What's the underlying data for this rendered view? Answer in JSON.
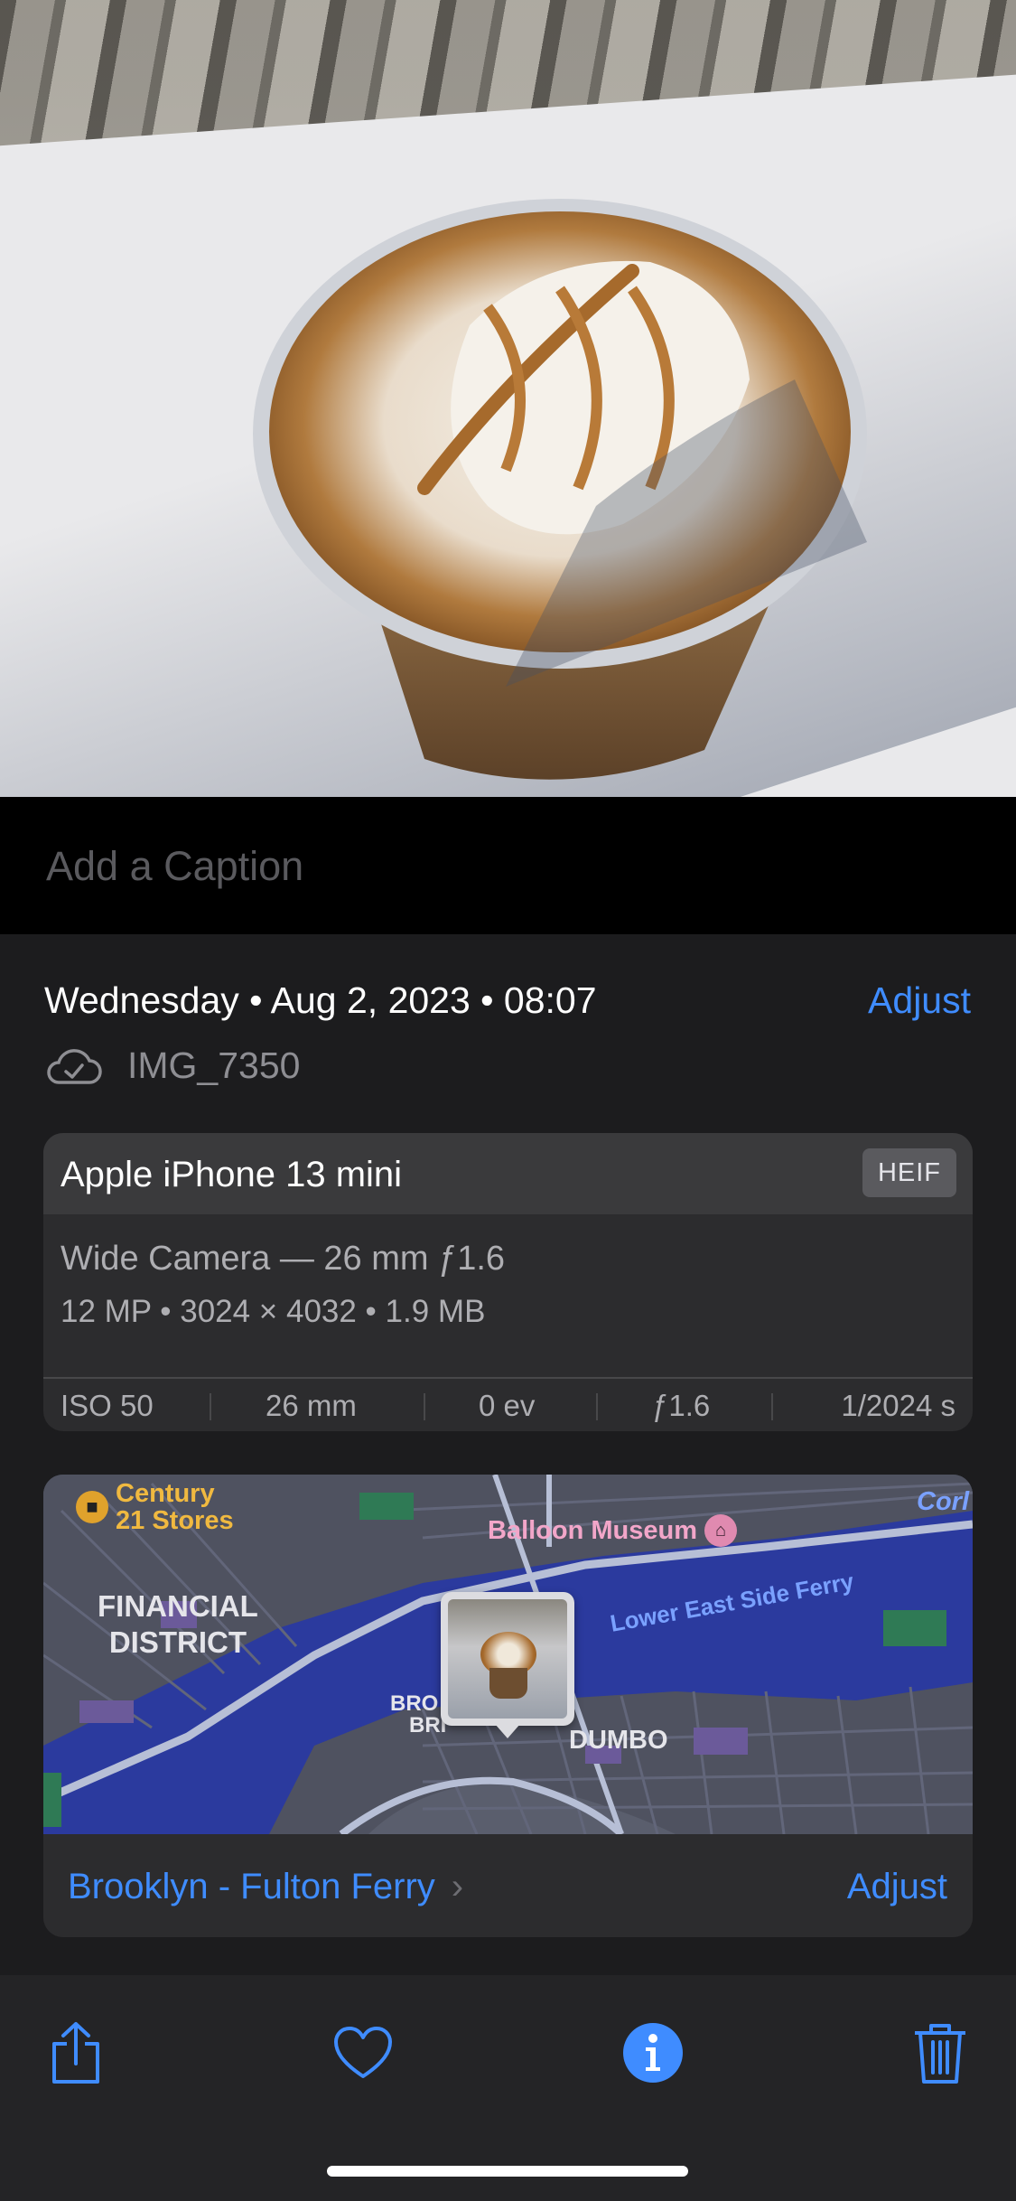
{
  "caption": {
    "placeholder": "Add a Caption"
  },
  "info": {
    "date": "Wednesday • Aug 2, 2023 • 08:07",
    "adjust_label": "Adjust",
    "filename": "IMG_7350",
    "cloud_icon": "icloud-synced-icon"
  },
  "camera": {
    "device": "Apple iPhone 13 mini",
    "format_badge": "HEIF",
    "lens": "Wide Camera — 26 mm ƒ1.6",
    "specs": "12 MP  •  3024 × 4032  •  1.9 MB",
    "exif": [
      "ISO 50",
      "26 mm",
      "0 ev",
      "ƒ1.6",
      "1/2024 s"
    ]
  },
  "map": {
    "labels": {
      "century": "Century",
      "century2": "21 Stores",
      "balloon": "Balloon Museum",
      "financial": "FINANCIAL",
      "district": "DISTRICT",
      "ferry": "Lower East Side Ferry",
      "dumbo": "DUMBO",
      "bro": "BRO",
      "bri": "BRI",
      "corl": "Corl"
    },
    "location_label": "Brooklyn - Fulton Ferry",
    "adjust_label": "Adjust",
    "colors": {
      "water": "#2b3a9e",
      "land": "#4f5260",
      "park": "#2f7a55",
      "road": "#b7bfd6"
    }
  },
  "toolbar": {
    "share_icon": "share-icon",
    "favorite_icon": "heart-icon",
    "info_icon": "info-icon",
    "delete_icon": "trash-icon",
    "accent": "#3f8cff"
  }
}
